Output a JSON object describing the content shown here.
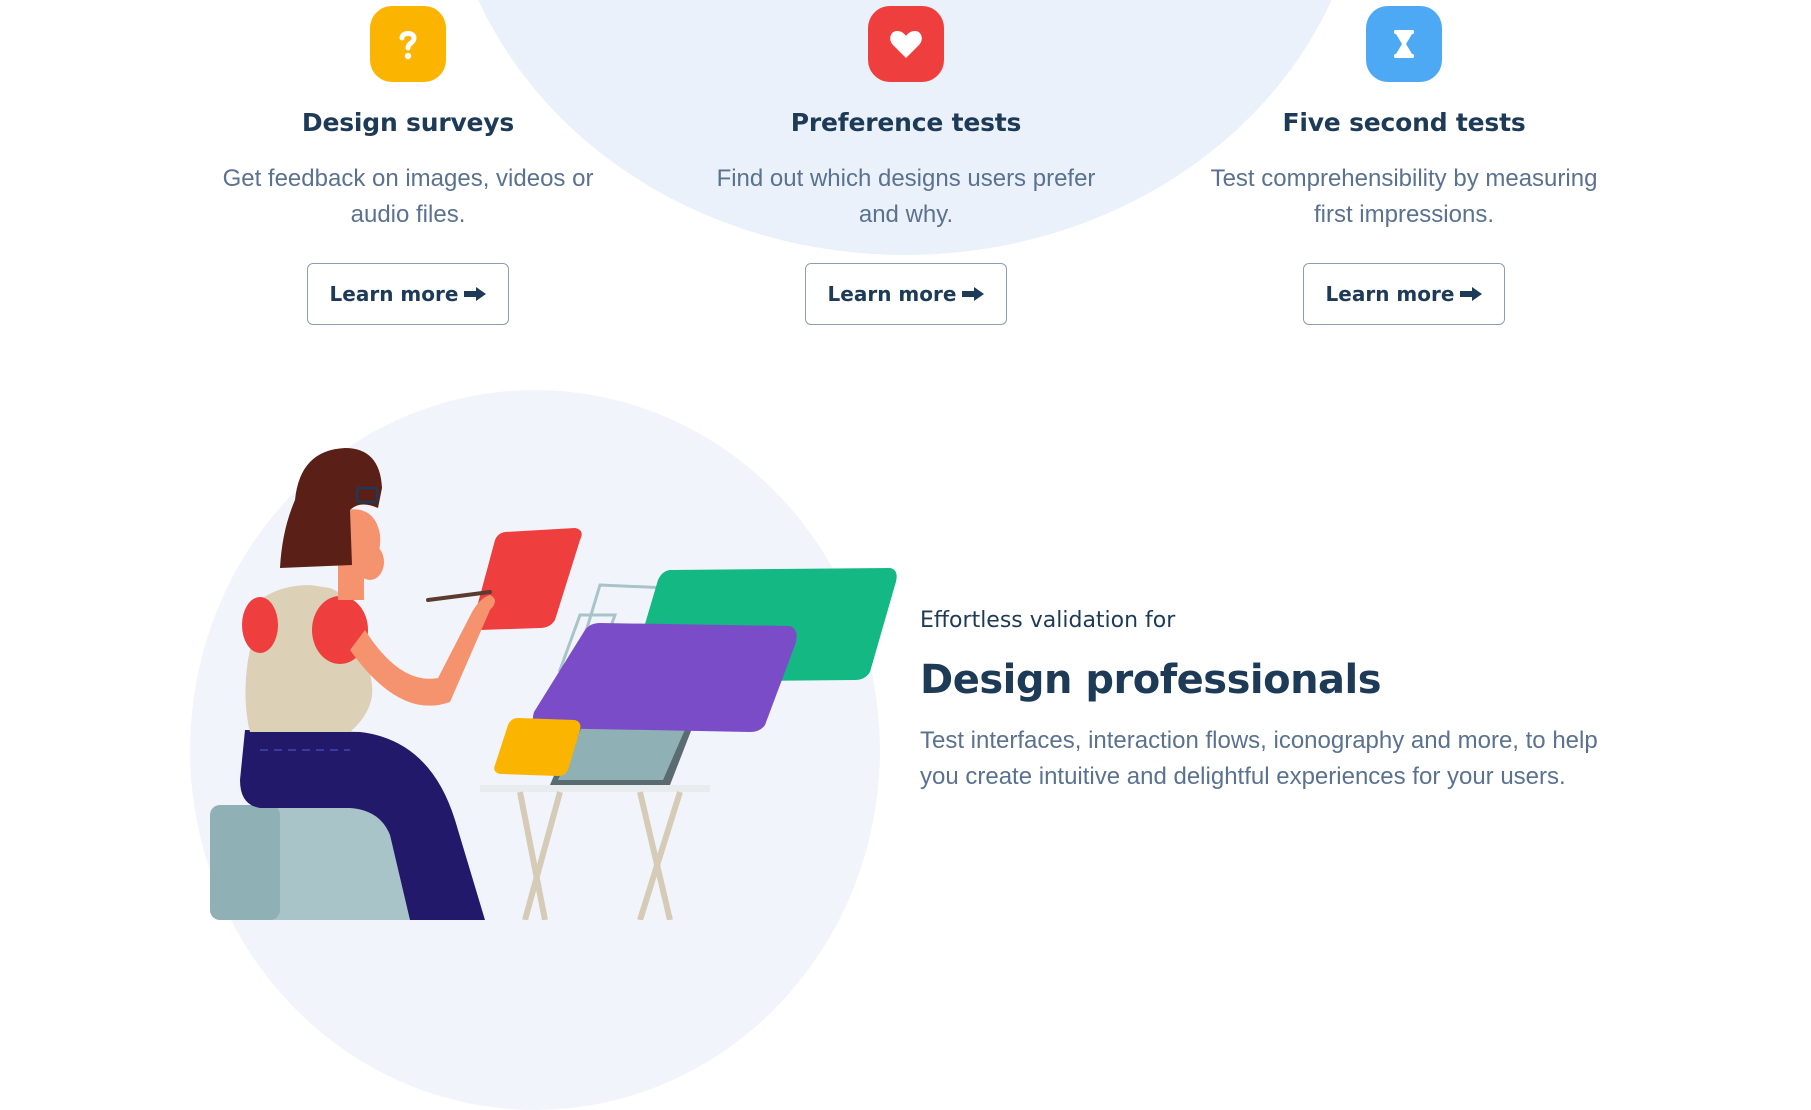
{
  "features": [
    {
      "icon": "question-mark-icon",
      "color": "#fbb400",
      "title": "Design surveys",
      "description": "Get feedback on images, videos or audio files.",
      "button_label": "Learn more"
    },
    {
      "icon": "heart-icon",
      "color": "#ef3e3e",
      "title": "Preference tests",
      "description": "Find out which designs users prefer and why.",
      "button_label": "Learn more"
    },
    {
      "icon": "hourglass-icon",
      "color": "#4ea9f5",
      "title": "Five second tests",
      "description": "Test comprehensibility by measuring first impressions.",
      "button_label": "Learn more"
    }
  ],
  "section": {
    "eyebrow": "Effortless validation for",
    "headline": "Design professionals",
    "body": "Test interfaces, interaction flows, iconography and more, to help you create intuitive and delightful experiences for your users."
  },
  "colors": {
    "text_dark": "#1d3a57",
    "text_muted": "#5a7290",
    "blob": "#eaf1fa"
  }
}
